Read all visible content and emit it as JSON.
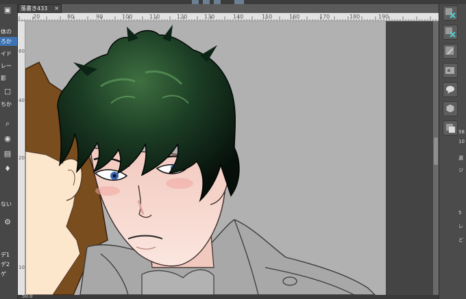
{
  "document": {
    "tab_title": "落書き433",
    "close_glyph": "✕"
  },
  "ruler": {
    "top_labels": [
      "20",
      "",
      "80",
      "90",
      "100",
      "110",
      "120",
      "130",
      "140",
      "150",
      "160",
      "170",
      "180",
      "190"
    ],
    "left_labels": [
      "60",
      "",
      "40",
      "",
      "20",
      "",
      "10"
    ]
  },
  "left_panel": {
    "items": [
      {
        "label": "体の",
        "selected": false
      },
      {
        "label": "ろか",
        "selected": true
      },
      {
        "label": "イド",
        "selected": false
      },
      {
        "label": "レー",
        "selected": false
      },
      {
        "label": "影",
        "selected": false
      },
      {
        "label": "ちか",
        "selected": false
      },
      {
        "label": "ない",
        "selected": false
      },
      {
        "label": "デ1",
        "selected": false
      },
      {
        "label": "デ2",
        "selected": false
      },
      {
        "label": "ゲ",
        "selected": false
      }
    ]
  },
  "status": {
    "zoom": "50.0"
  },
  "right_panel": {
    "side_labels": [
      "58",
      "10",
      "選",
      "ジ",
      "5",
      "レ",
      "ど"
    ]
  },
  "colors": {
    "canvas_bg": "#b1b1b1",
    "hair_main": "#0c2416",
    "hair_highlight": "#3b6b3b",
    "skin": "#f9dcd3",
    "brown_hair": "#7a4d1e",
    "selection_blue": "#3d74b3"
  }
}
